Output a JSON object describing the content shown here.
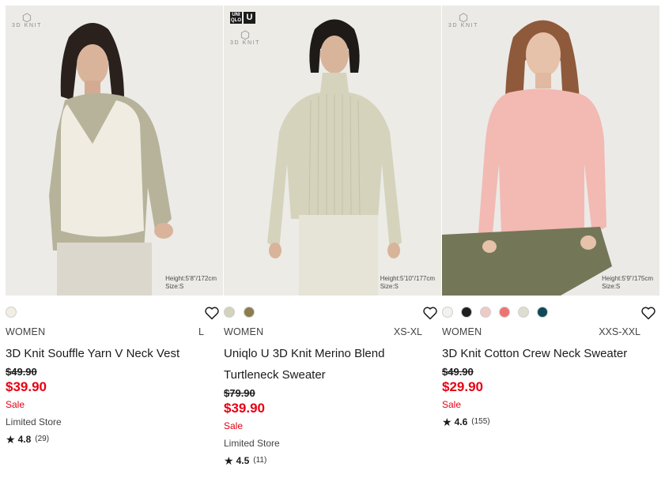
{
  "products": [
    {
      "badge_text": "3D KNIT",
      "height_caption": [
        "Height:5'8\"/172cm",
        "Size:S"
      ],
      "swatch_colors": [
        "#f1eee4"
      ],
      "gender": "WOMEN",
      "size_range": "L",
      "name": "3D Knit Souffle Yarn V Neck Vest",
      "name_line2": "",
      "original_price": "$49.90",
      "price": "$39.90",
      "sale_label": "Sale",
      "availability": "Limited Store",
      "rating": "4.8",
      "review_count": "(29)"
    },
    {
      "brand_logo": [
        "UNI QLO",
        "U"
      ],
      "badge_text": "3D KNIT",
      "height_caption": [
        "Height:5'10\"/177cm",
        "Size:S"
      ],
      "swatch_colors": [
        "#d3d2bb",
        "#8d7c4e"
      ],
      "gender": "WOMEN",
      "size_range": "XS-XL",
      "name": "Uniqlo U 3D Knit Merino Blend",
      "name_line2": "Turtleneck Sweater",
      "original_price": "$79.90",
      "price": "$39.90",
      "sale_label": "Sale",
      "availability": "Limited Store",
      "rating": "4.5",
      "review_count": "(11)"
    },
    {
      "badge_text": "3D KNIT",
      "height_caption": [
        "Height:5'9\"/175cm",
        "Size:S"
      ],
      "swatch_colors": [
        "#f4f2ec",
        "#1f1f1f",
        "#efc9c6",
        "#ef7272",
        "#deddd0",
        "#0d4a55"
      ],
      "gender": "WOMEN",
      "size_range": "XXS-XXL",
      "name": "3D Knit Cotton Crew Neck Sweater",
      "name_line2": "",
      "original_price": "$49.90",
      "price": "$29.90",
      "sale_label": "Sale",
      "availability": "",
      "rating": "4.6",
      "review_count": "(155)"
    }
  ]
}
